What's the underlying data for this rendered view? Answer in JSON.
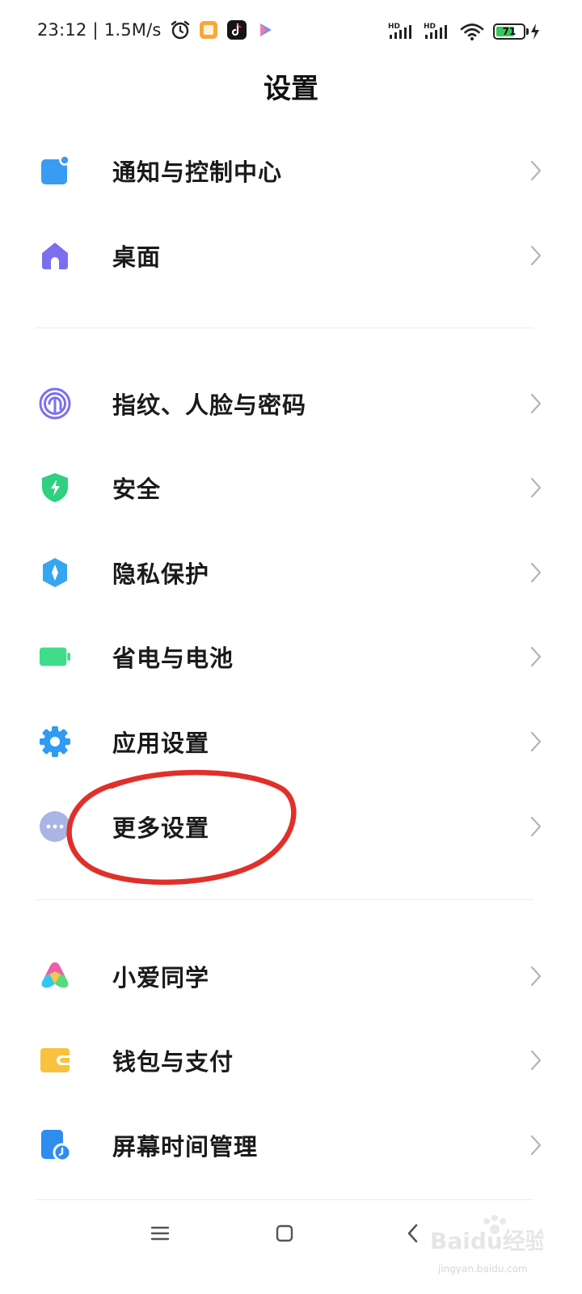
{
  "status_bar": {
    "time": "23:12",
    "separator": "|",
    "net_speed": "1.5M/s",
    "app_icons": [
      "alarm-icon",
      "notes-icon",
      "tiktok-icon",
      "play-icon"
    ],
    "signal_labels": [
      "HD",
      "HD"
    ],
    "battery_level": "71",
    "battery_fraction": 0.71
  },
  "header": {
    "title": "设置"
  },
  "sections": [
    {
      "items": [
        {
          "label": "通知与控制中心",
          "icon": "notification-icon"
        },
        {
          "label": "桌面",
          "icon": "home-icon"
        }
      ]
    },
    {
      "items": [
        {
          "label": "指纹、人脸与密码",
          "icon": "fingerprint-icon"
        },
        {
          "label": "安全",
          "icon": "shield-icon"
        },
        {
          "label": "隐私保护",
          "icon": "privacy-icon"
        },
        {
          "label": "省电与电池",
          "icon": "battery-icon"
        },
        {
          "label": "应用设置",
          "icon": "gear-icon"
        },
        {
          "label": "更多设置",
          "icon": "more-icon"
        }
      ]
    },
    {
      "items": [
        {
          "label": "小爱同学",
          "icon": "xiaoai-icon"
        },
        {
          "label": "钱包与支付",
          "icon": "wallet-icon"
        },
        {
          "label": "屏幕时间管理",
          "icon": "screen-time-icon"
        }
      ]
    }
  ],
  "nav_bar": {
    "buttons": [
      "menu-icon",
      "home-square-icon",
      "back-icon"
    ]
  },
  "watermark": {
    "text": "jingyan.baidu.com",
    "logo_text": "Baidu经验"
  },
  "colors": {
    "notification": "#3a9bf5",
    "home": "#7b6ff0",
    "fingerprint": "#7b6ff0",
    "shield": "#2fd07f",
    "privacy": "#35a6ef",
    "battery": "#3fdc8a",
    "gear": "#2f9bf3",
    "more": "#aab5e6",
    "wallet": "#f8c23e",
    "screen_time": "#2f8df0",
    "annotation": "#e0302a",
    "chevron": "#b4b4b4"
  }
}
